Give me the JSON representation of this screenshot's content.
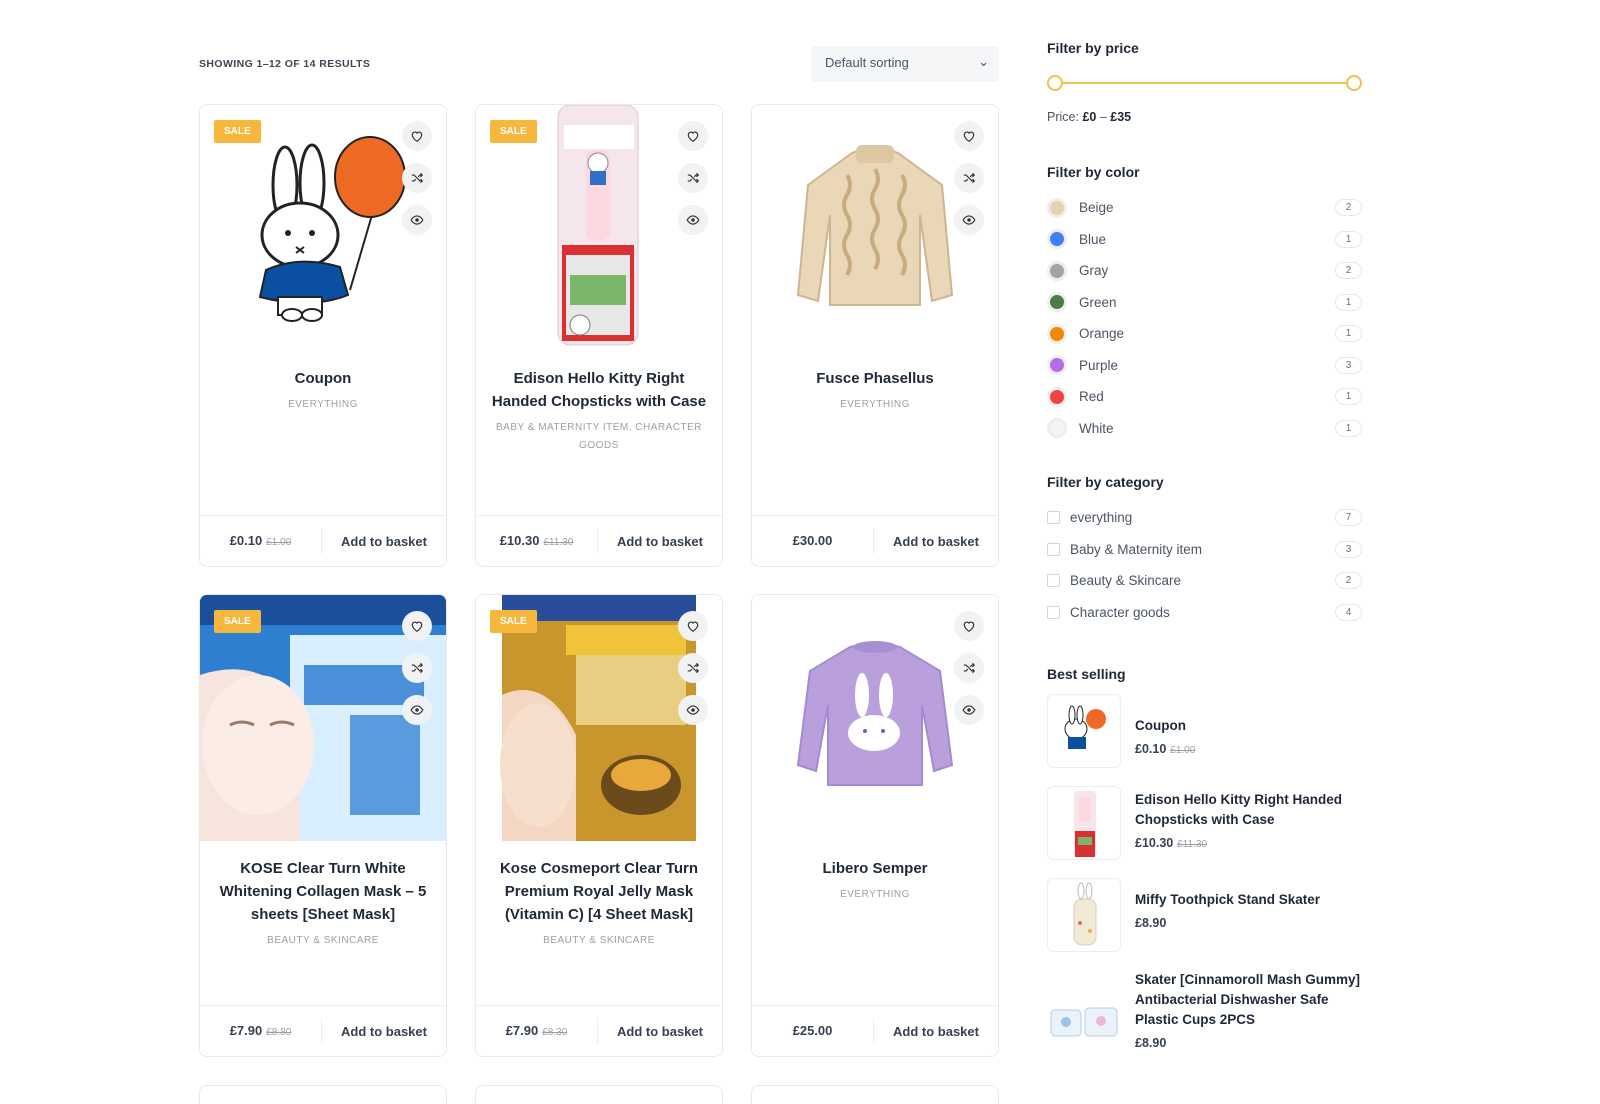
{
  "toolbar": {
    "result_count": "SHOWING 1–12 OF 14 RESULTS",
    "sort_value": "Default sorting"
  },
  "products": [
    {
      "name": "Coupon",
      "category": "EVERYTHING",
      "price": "£0.10",
      "old_price": "£1.00",
      "sale": "SALE",
      "button": "Add to basket",
      "image": "miffy-balloon"
    },
    {
      "name": "Edison Hello Kitty Right Handed Chopsticks with Case",
      "category": "BABY & MATERNITY ITEM, CHARACTER GOODS",
      "price": "£10.30",
      "old_price": "£11.30",
      "sale": "SALE",
      "button": "Add to basket",
      "image": "hello-kitty-chopsticks"
    },
    {
      "name": "Fusce Phasellus",
      "category": "EVERYTHING",
      "price": "£30.00",
      "old_price": "",
      "sale": "",
      "button": "Add to basket",
      "image": "beige-knit-sweater"
    },
    {
      "name": "KOSE Clear Turn White Whitening Collagen Mask – 5 sheets [Sheet Mask]",
      "category": "BEAUTY & SKINCARE",
      "price": "£7.90",
      "old_price": "£8.80",
      "sale": "SALE",
      "button": "Add to basket",
      "image": "kose-collagen-mask"
    },
    {
      "name": "Kose Cosmeport Clear Turn Premium Royal Jelly Mask (Vitamin C) [4 Sheet Mask]",
      "category": "BEAUTY & SKINCARE",
      "price": "£7.90",
      "old_price": "£8.30",
      "sale": "SALE",
      "button": "Add to basket",
      "image": "kose-royal-jelly-mask"
    },
    {
      "name": "Libero Semper",
      "category": "EVERYTHING",
      "price": "£25.00",
      "old_price": "",
      "sale": "",
      "button": "Add to basket",
      "image": "purple-bunny-sweater"
    }
  ],
  "sidebar": {
    "price": {
      "title": "Filter by price",
      "label": "Price:",
      "min": "£0",
      "max": "£35",
      "accent": "#f1c04f"
    },
    "colors": {
      "title": "Filter by color",
      "items": [
        {
          "name": "Beige",
          "count": "2",
          "hex": "#e8d2b0"
        },
        {
          "name": "Blue",
          "count": "1",
          "hex": "#3b82f6"
        },
        {
          "name": "Gray",
          "count": "2",
          "hex": "#a3a3a3"
        },
        {
          "name": "Green",
          "count": "1",
          "hex": "#4a7c45"
        },
        {
          "name": "Orange",
          "count": "1",
          "hex": "#f28705"
        },
        {
          "name": "Purple",
          "count": "3",
          "hex": "#b66ee8"
        },
        {
          "name": "Red",
          "count": "1",
          "hex": "#ef4444"
        },
        {
          "name": "White",
          "count": "1",
          "hex": "#f4f4f4"
        }
      ]
    },
    "categories": {
      "title": "Filter by category",
      "items": [
        {
          "name": "everything",
          "count": "7"
        },
        {
          "name": "Baby & Maternity item",
          "count": "3"
        },
        {
          "name": "Beauty & Skincare",
          "count": "2"
        },
        {
          "name": "Character goods",
          "count": "4"
        }
      ]
    },
    "best_selling": {
      "title": "Best selling",
      "items": [
        {
          "name": "Coupon",
          "price": "£0.10",
          "old_price": "£1.00",
          "image": "miffy-balloon"
        },
        {
          "name": "Edison Hello Kitty Right Handed Chopsticks with Case",
          "price": "£10.30",
          "old_price": "£11.30",
          "image": "hello-kitty-chopsticks"
        },
        {
          "name": "Miffy Toothpick Stand Skater",
          "price": "£8.90",
          "old_price": "",
          "image": "miffy-toothpick-stand"
        },
        {
          "name": "Skater [Cinnamoroll Mash Gummy] Antibacterial Dishwasher Safe Plastic Cups 2PCS",
          "price": "£8.90",
          "old_price": "",
          "image": "cinnamoroll-cups"
        }
      ]
    }
  }
}
